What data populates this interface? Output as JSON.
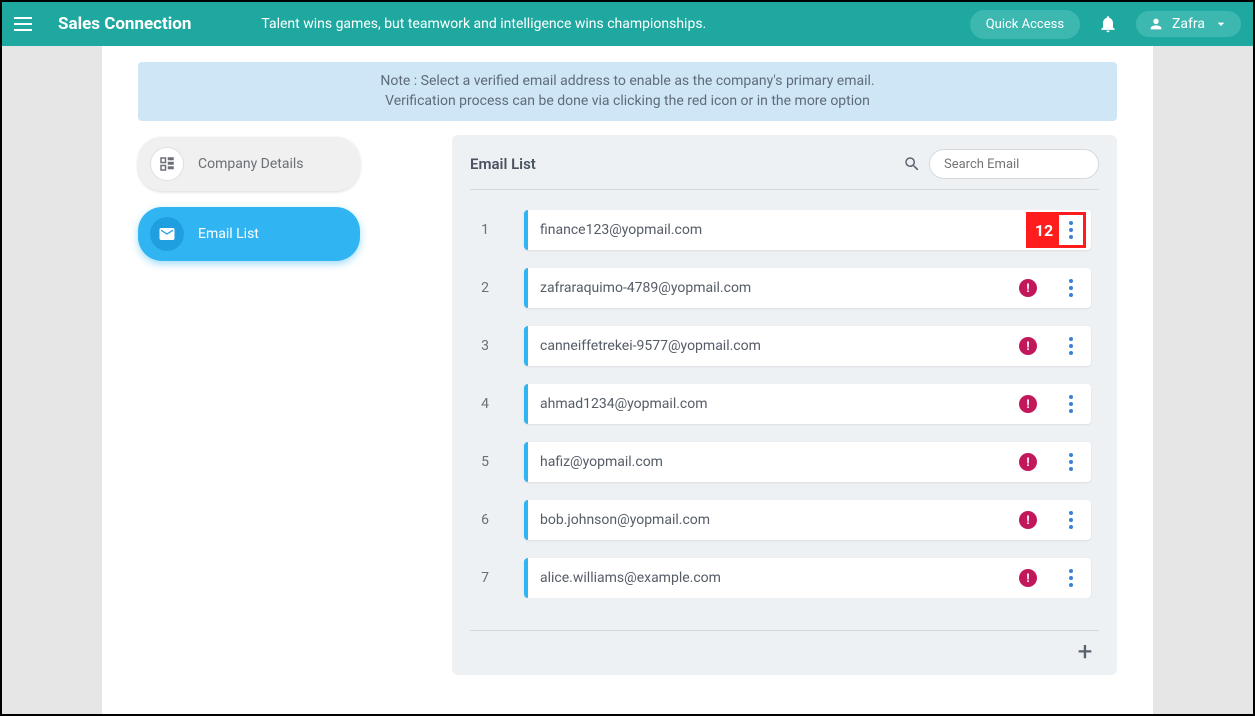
{
  "header": {
    "app_title": "Sales Connection",
    "tagline": "Talent wins games, but teamwork and intelligence wins championships.",
    "quick_access_label": "Quick Access",
    "user_name": "Zafra"
  },
  "note": {
    "line1": "Note : Select a verified email address to enable as the company's primary email.",
    "line2": "Verification process can be done via clicking the red icon or in the more option"
  },
  "nav": {
    "company_details": "Company Details",
    "email_list": "Email List"
  },
  "panel": {
    "title": "Email List",
    "search_placeholder": "Search Email",
    "highlight_number": "12"
  },
  "emails": [
    {
      "idx": "1",
      "address": "finance123@yopmail.com",
      "warn": false,
      "highlighted": true
    },
    {
      "idx": "2",
      "address": "zafraraquimo-4789@yopmail.com",
      "warn": true,
      "highlighted": false
    },
    {
      "idx": "3",
      "address": "canneiffetrekei-9577@yopmail.com",
      "warn": true,
      "highlighted": false
    },
    {
      "idx": "4",
      "address": "ahmad1234@yopmail.com",
      "warn": true,
      "highlighted": false
    },
    {
      "idx": "5",
      "address": "hafiz@yopmail.com",
      "warn": true,
      "highlighted": false
    },
    {
      "idx": "6",
      "address": "bob.johnson@yopmail.com",
      "warn": true,
      "highlighted": false
    },
    {
      "idx": "7",
      "address": "alice.williams@example.com",
      "warn": true,
      "highlighted": false
    }
  ]
}
